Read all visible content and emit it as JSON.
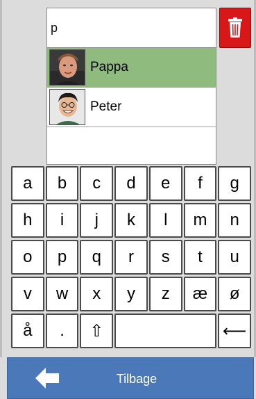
{
  "search": {
    "value": "p"
  },
  "trash": {
    "icon": "trash-icon"
  },
  "results": [
    {
      "name": "Pappa",
      "selected": true
    },
    {
      "name": "Peter",
      "selected": false
    }
  ],
  "keyboard": {
    "rows": [
      [
        "a",
        "b",
        "c",
        "d",
        "e",
        "f",
        "g"
      ],
      [
        "h",
        "i",
        "j",
        "k",
        "l",
        "m",
        "n"
      ],
      [
        "o",
        "p",
        "q",
        "r",
        "s",
        "t",
        "u"
      ],
      [
        "v",
        "w",
        "x",
        "y",
        "z",
        "æ",
        "ø"
      ]
    ],
    "last_row": {
      "aa": "å",
      "dot": ".",
      "shift": "⇧",
      "backspace": "⟵"
    }
  },
  "bottom": {
    "back_label": "Tilbage",
    "icon": "back-arrow-icon"
  },
  "colors": {
    "selected_row": "#8fbc7e",
    "trash": "#d81818",
    "bottom_bar": "#4a78b8"
  }
}
